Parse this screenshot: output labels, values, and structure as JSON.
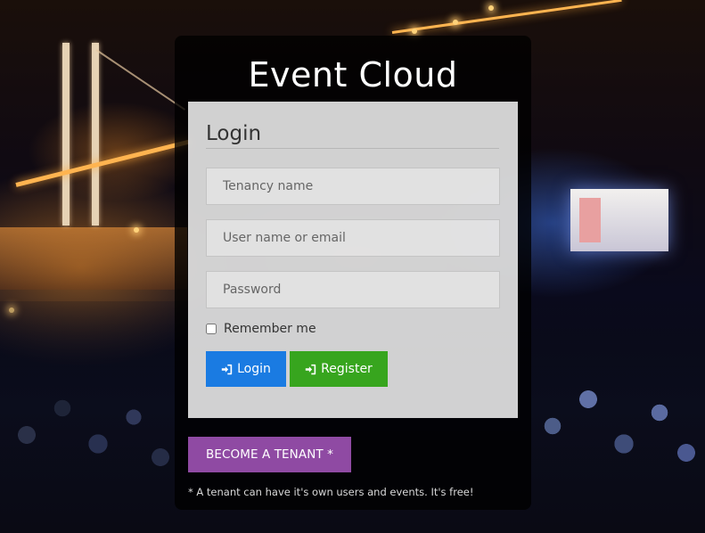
{
  "app": {
    "title": "Event Cloud"
  },
  "login_form": {
    "heading": "Login",
    "tenancy_placeholder": "Tenancy name",
    "username_placeholder": "User name or email",
    "password_placeholder": "Password",
    "remember_label": "Remember me",
    "remember_checked": false,
    "login_button": "Login",
    "register_button": "Register"
  },
  "tenant": {
    "button_label": "BECOME A TENANT *",
    "note": "* A tenant can have it's own users and events. It's free!"
  },
  "colors": {
    "login_button": "#1a7be2",
    "register_button": "#37a51e",
    "tenant_button": "#8f4aa3",
    "panel": "rgba(0,0,0,0.78)"
  },
  "icons": {
    "login": "sign-in-icon",
    "register": "sign-in-icon"
  }
}
